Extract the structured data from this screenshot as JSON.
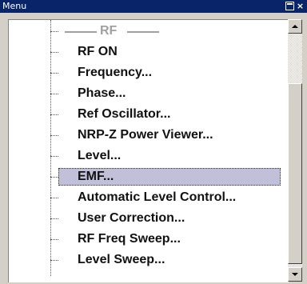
{
  "window": {
    "title": "Menu"
  },
  "menu": {
    "section_header": "RF",
    "items": [
      {
        "label": "RF ON"
      },
      {
        "label": "Frequency..."
      },
      {
        "label": "Phase..."
      },
      {
        "label": "Ref Oscillator..."
      },
      {
        "label": "NRP-Z Power Viewer..."
      },
      {
        "label": "Level..."
      },
      {
        "label": "EMF...",
        "selected": true
      },
      {
        "label": "Automatic Level Control..."
      },
      {
        "label": "User Correction..."
      },
      {
        "label": "RF Freq Sweep..."
      },
      {
        "label": "Level Sweep..."
      }
    ]
  },
  "scrollbar": {
    "position": 0.3
  },
  "colors": {
    "titlebar": "#0a246a",
    "selection": "#c0c0d8",
    "header_text": "#a0a0a0"
  }
}
